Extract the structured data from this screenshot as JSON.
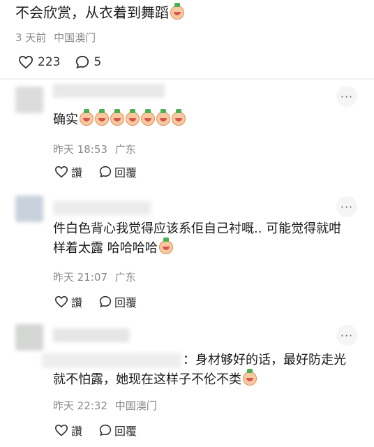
{
  "post": {
    "text": "不会欣赏，从衣着到舞蹈",
    "time": "3 天前",
    "location": "中国澳门",
    "likes": "223",
    "comments": "5"
  },
  "comments": [
    {
      "text": "确实",
      "emoji_count": 7,
      "time": "昨天 18:53",
      "location": "广东",
      "like_label": "讚",
      "reply_label": "回覆"
    },
    {
      "text": "件白色背心我觉得应该系佢自己衬嘅.. 可能觉得就咁样着太露 哈哈哈哈",
      "time": "昨天 21:07",
      "location": "广东",
      "like_label": "讚",
      "reply_label": "回覆"
    },
    {
      "text": "：身材够好的话，最好防走光就不怕露，她现在这样子不伦不类",
      "time": "昨天 22:32",
      "location": "中国澳门",
      "like_label": "讚",
      "reply_label": "回覆"
    }
  ],
  "more_glyph": "···",
  "colors": {
    "meta": "#8a8a8a",
    "text": "#1a1a1a",
    "more_bg": "#f5f5f5"
  }
}
